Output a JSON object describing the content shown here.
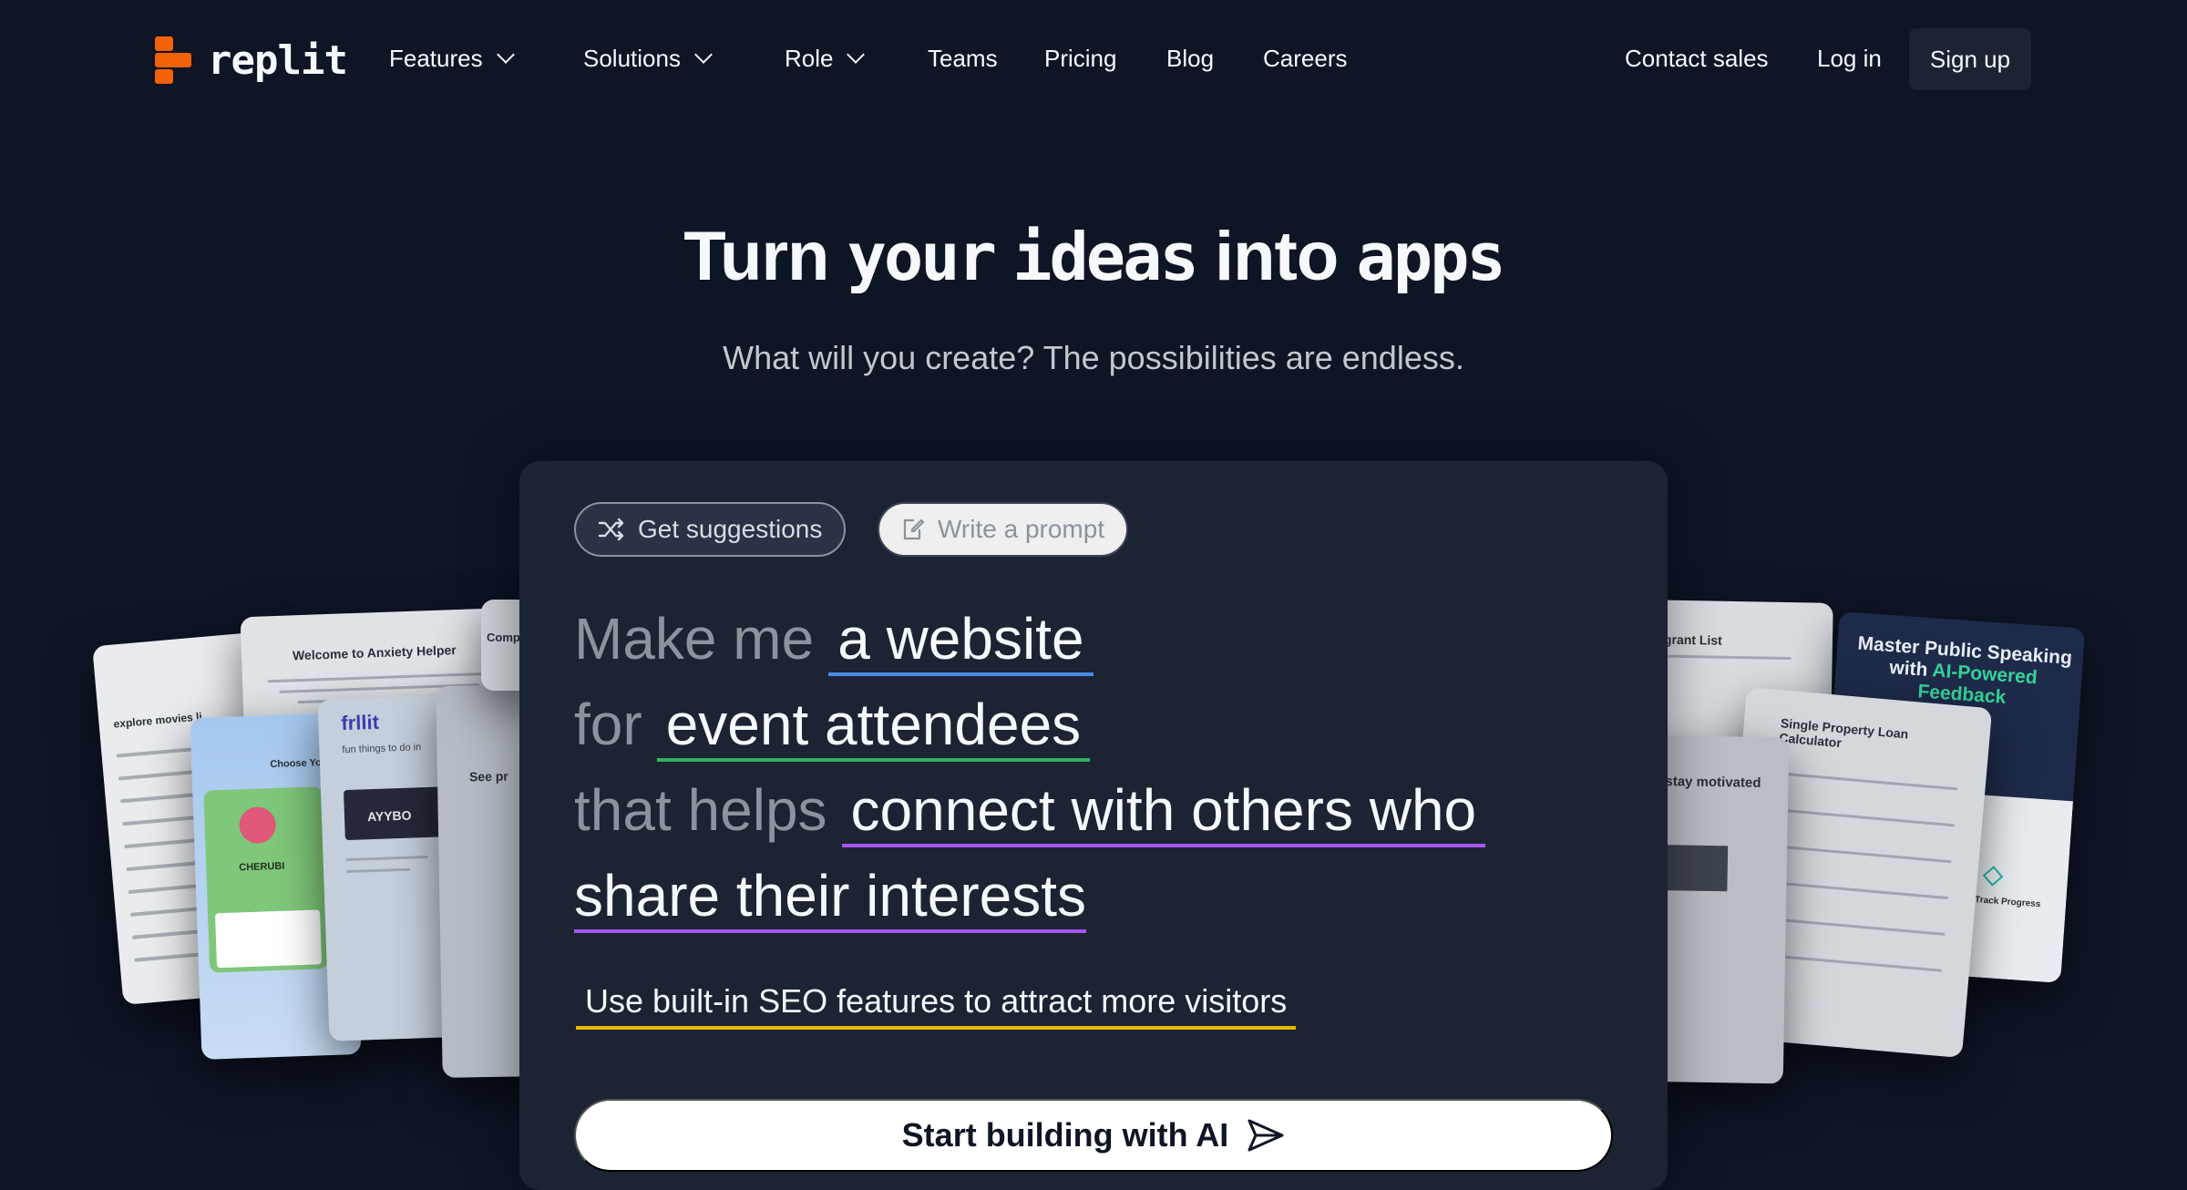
{
  "nav": {
    "logo_text": "replit",
    "items": [
      "Features",
      "Solutions",
      "Role",
      "Teams",
      "Pricing",
      "Blog",
      "Careers"
    ],
    "contact_sales": "Contact sales",
    "log_in": "Log in",
    "sign_up": "Sign up"
  },
  "hero": {
    "title_a": "Turn",
    "title_b": "your",
    "title_c": "ideas",
    "title_d": "into",
    "title_e": "apps",
    "subtitle": "What will you create? The possibilities are endless."
  },
  "prompt": {
    "tab_suggestions": "Get suggestions",
    "tab_write": "Write a prompt",
    "line1_prefix": "Make me",
    "line1_value": "a website",
    "line2_prefix": "for",
    "line2_value": "event attendees",
    "line3_prefix": "that helps",
    "line3_value": "connect with others who",
    "line4_value": "share their interests",
    "feature": "Use built-in SEO features to attract more visitors",
    "cta": "Start building with AI"
  },
  "previews": {
    "anxiety_title": "Welcome to Anxiety Helper",
    "movies_title": "explore movies li",
    "pokemon_title": "Choose Your Po",
    "pokemon_name": "CHERUBI",
    "frllit_title": "frllit",
    "frllit_sub": "fun things to do in",
    "frllit_event": "AYYBO",
    "see_title": "See pr",
    "comp_title": "Comp",
    "grant_title": "grant List",
    "motivated_title": "stay motivated",
    "speaking_title": "Master Public Speaking with",
    "speaking_highlight": "AI-Powered Feedback",
    "loan_title": "Single Property Loan Calculator",
    "track_title": "Track Progress"
  },
  "colors": {
    "background": "#0e1525",
    "panel": "#1c2333",
    "brand_orange": "#f26207",
    "underline_blue": "#4b8ae3",
    "underline_green": "#2fb35f",
    "underline_purple": "#a557f0",
    "underline_yellow": "#e6b800"
  },
  "icons": {
    "shuffle": "shuffle-icon",
    "edit": "edit-icon",
    "send": "send-icon",
    "chevron": "chevron-down-icon"
  }
}
